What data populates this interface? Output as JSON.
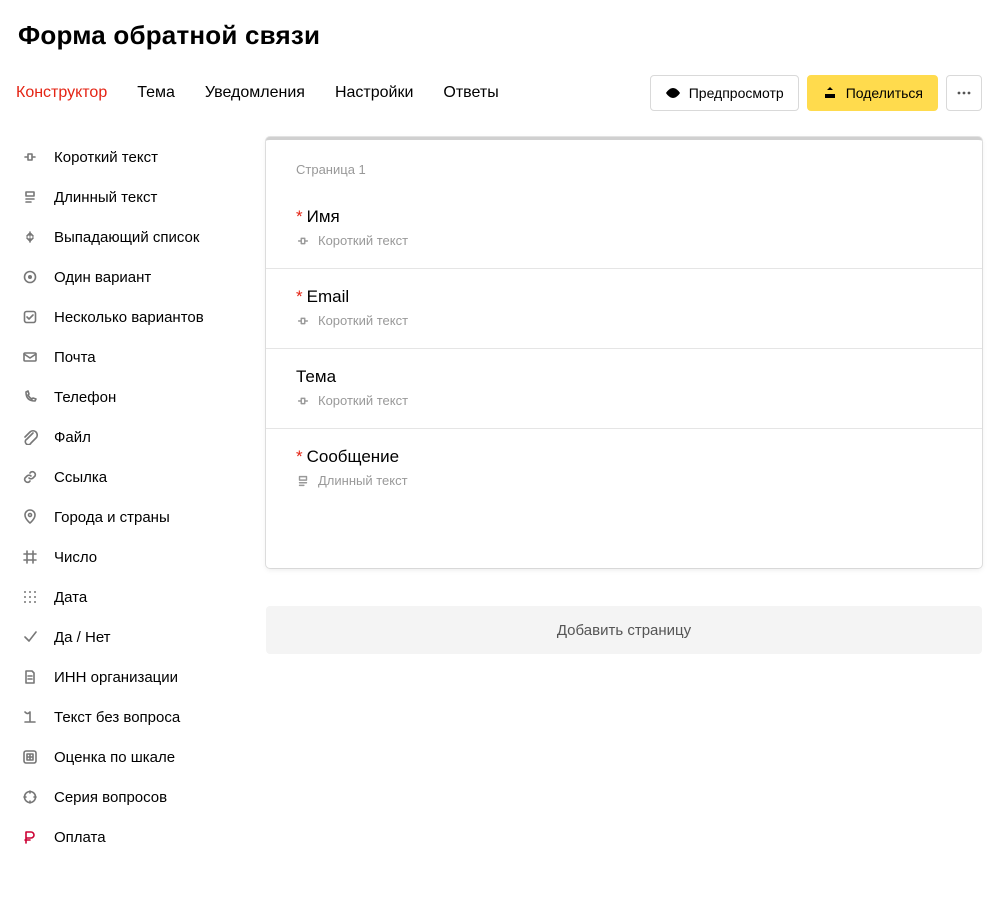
{
  "title": "Форма обратной связи",
  "tabs": {
    "constructor": "Конструктор",
    "theme": "Тема",
    "notifications": "Уведомления",
    "settings": "Настройки",
    "answers": "Ответы"
  },
  "buttons": {
    "preview": "Предпросмотр",
    "share": "Поделиться"
  },
  "sidebar": {
    "items": [
      {
        "id": "short-text",
        "label": "Короткий текст"
      },
      {
        "id": "long-text",
        "label": "Длинный текст"
      },
      {
        "id": "dropdown",
        "label": "Выпадающий список"
      },
      {
        "id": "radio",
        "label": "Один вариант"
      },
      {
        "id": "checkbox",
        "label": "Несколько вариантов"
      },
      {
        "id": "email",
        "label": "Почта"
      },
      {
        "id": "phone",
        "label": "Телефон"
      },
      {
        "id": "file",
        "label": "Файл"
      },
      {
        "id": "link",
        "label": "Ссылка"
      },
      {
        "id": "geo",
        "label": "Города и страны"
      },
      {
        "id": "number",
        "label": "Число"
      },
      {
        "id": "date",
        "label": "Дата"
      },
      {
        "id": "yesno",
        "label": "Да / Нет"
      },
      {
        "id": "inn",
        "label": "ИНН организации"
      },
      {
        "id": "text-only",
        "label": "Текст без вопроса"
      },
      {
        "id": "scale",
        "label": "Оценка по шкале"
      },
      {
        "id": "series",
        "label": "Серия вопросов"
      },
      {
        "id": "payment",
        "label": "Оплата"
      }
    ]
  },
  "page": {
    "label": "Страница 1",
    "fields": [
      {
        "label": "Имя",
        "required": true,
        "type_label": "Короткий текст",
        "type": "short"
      },
      {
        "label": "Email",
        "required": true,
        "type_label": "Короткий текст",
        "type": "short"
      },
      {
        "label": "Тема",
        "required": false,
        "type_label": "Короткий текст",
        "type": "short"
      },
      {
        "label": "Сообщение",
        "required": true,
        "type_label": "Длинный текст",
        "type": "long"
      }
    ]
  },
  "add_page": "Добавить страницу"
}
